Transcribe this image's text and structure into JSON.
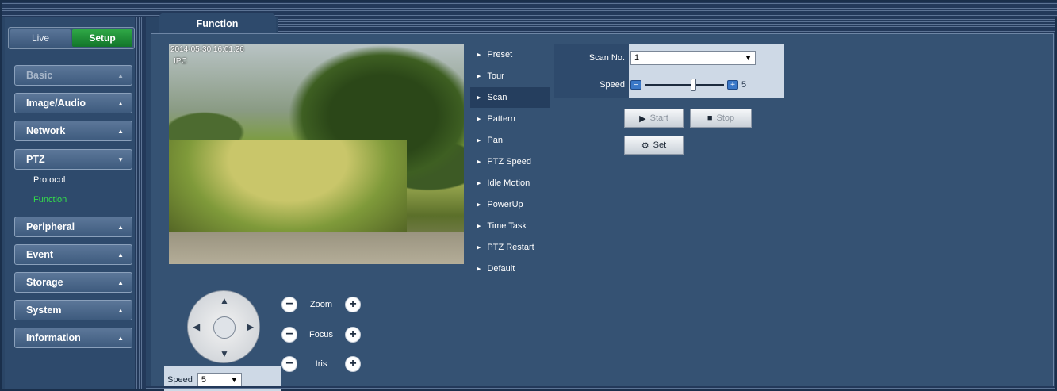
{
  "mode": {
    "live": "Live",
    "setup": "Setup"
  },
  "sidebar": {
    "basic": "Basic",
    "image_audio": "Image/Audio",
    "network": "Network",
    "ptz": "PTZ",
    "ptz_sub": {
      "protocol": "Protocol",
      "function": "Function"
    },
    "peripheral": "Peripheral",
    "event": "Event",
    "storage": "Storage",
    "system": "System",
    "information": "Information"
  },
  "tab": {
    "title": "Function"
  },
  "video": {
    "timestamp": "2014-05-30 16:01:26",
    "channel": "IPC"
  },
  "ptz_control": {
    "zoom_label": "Zoom",
    "focus_label": "Focus",
    "iris_label": "Iris",
    "speed_label": "Speed",
    "speed_value": "5"
  },
  "functions": [
    "Preset",
    "Tour",
    "Scan",
    "Pattern",
    "Pan",
    "PTZ Speed",
    "Idle Motion",
    "PowerUp",
    "Time Task",
    "PTZ Restart",
    "Default"
  ],
  "functions_active": "Scan",
  "scan": {
    "scan_no_label": "Scan No.",
    "scan_no_value": "1",
    "speed_label": "Speed",
    "speed_value": "5",
    "speed_fraction": 0.62,
    "start_label": "Start",
    "stop_label": "Stop",
    "set_label": "Set"
  }
}
